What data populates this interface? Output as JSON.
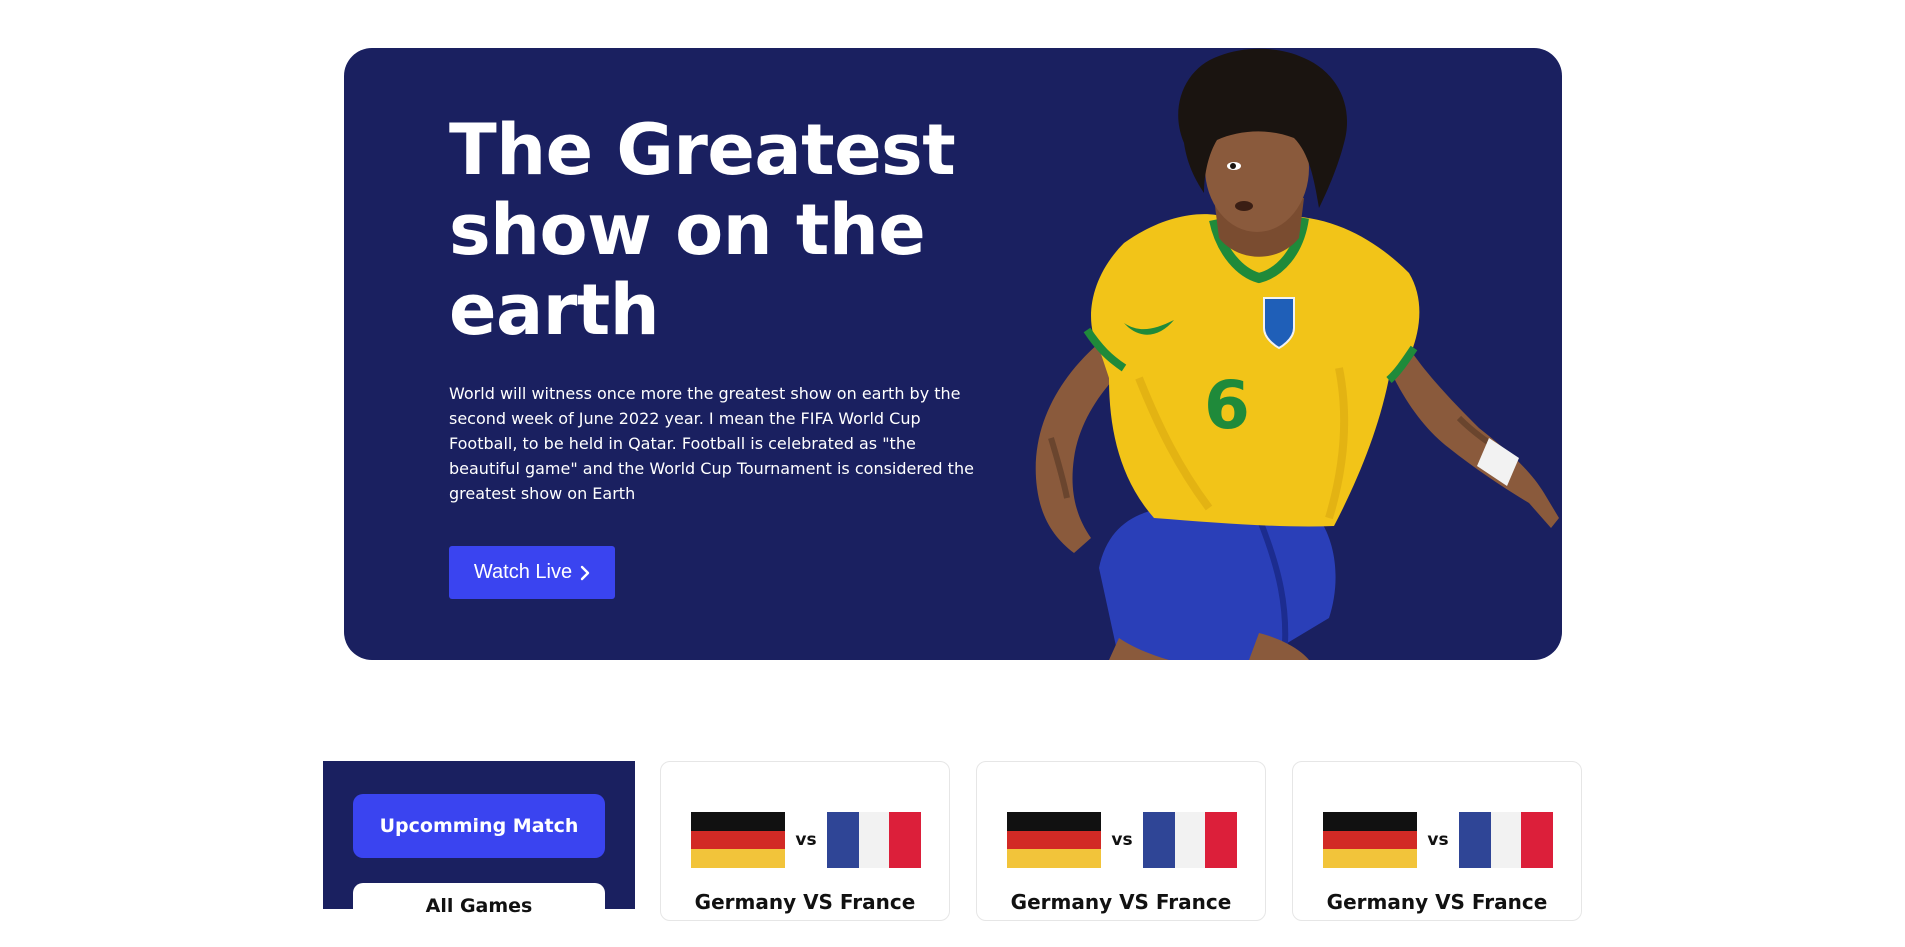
{
  "hero": {
    "title": "The Greatest show on the earth",
    "description": "World will witness once more the greatest show on earth by the second week of June 2022 year. I mean the FIFA World Cup Football, to be held in Qatar. Football is celebrated as \"the beautiful game\" and the World Cup Tournament is considered the greatest show on Earth",
    "button_label": "Watch Live",
    "button_icon": "chevron-right-icon",
    "image": "football-player-brazil-jersey-6",
    "background_color": "#1a2060",
    "accent_color": "#3a44f0"
  },
  "sidebar": {
    "tabs": [
      {
        "label": "Upcomming Match",
        "active": true
      },
      {
        "label": "All Games",
        "active": false
      }
    ]
  },
  "matches": [
    {
      "team_a": "Germany",
      "team_b": "France",
      "vs_label": "vs",
      "title": "Germany VS France"
    },
    {
      "team_a": "Germany",
      "team_b": "France",
      "vs_label": "vs",
      "title": "Germany VS France"
    },
    {
      "team_a": "Germany",
      "team_b": "France",
      "vs_label": "vs",
      "title": "Germany VS France"
    }
  ]
}
